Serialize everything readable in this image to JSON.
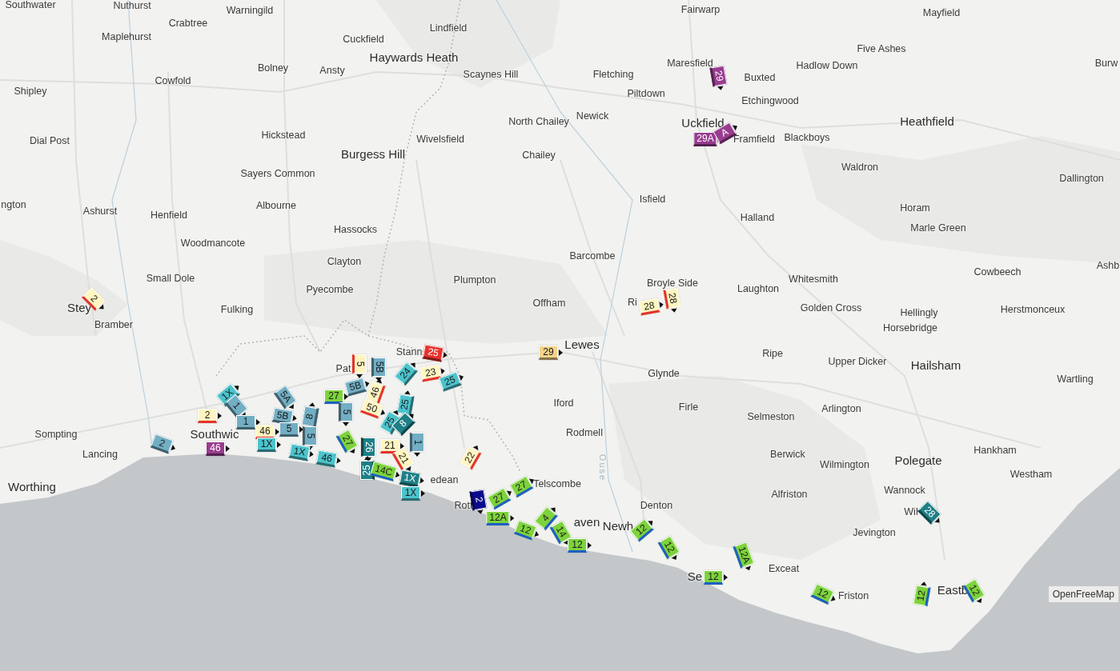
{
  "map": {
    "places": [
      {
        "name": "Southwater",
        "kind": "village"
      },
      {
        "name": "Nuthurst",
        "kind": "village"
      },
      {
        "name": "Warningild",
        "kind": "village"
      },
      {
        "name": "Crabtree",
        "kind": "village"
      },
      {
        "name": "Maplehurst",
        "kind": "village"
      },
      {
        "name": "Lindfield",
        "kind": "village"
      },
      {
        "name": "Cuckfield",
        "kind": "village"
      },
      {
        "name": "Bolney",
        "kind": "village"
      },
      {
        "name": "Haywards Heath",
        "kind": "town"
      },
      {
        "name": "Ansty",
        "kind": "village"
      },
      {
        "name": "Cowfold",
        "kind": "village"
      },
      {
        "name": "Scaynes Hill",
        "kind": "village"
      },
      {
        "name": "Shipley",
        "kind": "village"
      },
      {
        "name": "North Chailey",
        "kind": "village"
      },
      {
        "name": "Dial Post",
        "kind": "village"
      },
      {
        "name": "Hickstead",
        "kind": "village"
      },
      {
        "name": "Wivelsfield",
        "kind": "village"
      },
      {
        "name": "Burgess Hill",
        "kind": "town"
      },
      {
        "name": "Chailey",
        "kind": "village"
      },
      {
        "name": "Sayers Common",
        "kind": "village"
      },
      {
        "name": "ngton",
        "kind": "village"
      },
      {
        "name": "Ashurst",
        "kind": "village"
      },
      {
        "name": "Henfield",
        "kind": "village"
      },
      {
        "name": "Albourne",
        "kind": "village"
      },
      {
        "name": "Hassocks",
        "kind": "village"
      },
      {
        "name": "Woodmancote",
        "kind": "village"
      },
      {
        "name": "Clayton",
        "kind": "village"
      },
      {
        "name": "Small Dole",
        "kind": "village"
      },
      {
        "name": "Pyecombe",
        "kind": "village"
      },
      {
        "name": "Plumpton",
        "kind": "village"
      },
      {
        "name": "Stey",
        "kind": "town"
      },
      {
        "name": "Fulking",
        "kind": "village"
      },
      {
        "name": "Offham",
        "kind": "village"
      },
      {
        "name": "Bramber",
        "kind": "village"
      },
      {
        "name": "Fairwarp",
        "kind": "village"
      },
      {
        "name": "Mayfield",
        "kind": "village"
      },
      {
        "name": "Five Ashes",
        "kind": "village"
      },
      {
        "name": "Maresfield",
        "kind": "village"
      },
      {
        "name": "Hadlow Down",
        "kind": "village"
      },
      {
        "name": "Burw",
        "kind": "village"
      },
      {
        "name": "Fletching",
        "kind": "village"
      },
      {
        "name": "Buxted",
        "kind": "village"
      },
      {
        "name": "Piltdown",
        "kind": "village"
      },
      {
        "name": "Etchingwood",
        "kind": "village"
      },
      {
        "name": "Newick",
        "kind": "village"
      },
      {
        "name": "Uckfield",
        "kind": "town"
      },
      {
        "name": "Heathfield",
        "kind": "town"
      },
      {
        "name": "Framfield",
        "kind": "village"
      },
      {
        "name": "Blackboys",
        "kind": "village"
      },
      {
        "name": "Waldron",
        "kind": "village"
      },
      {
        "name": "Dallington",
        "kind": "village"
      },
      {
        "name": "Isfield",
        "kind": "village"
      },
      {
        "name": "Halland",
        "kind": "village"
      },
      {
        "name": "Horam",
        "kind": "village"
      },
      {
        "name": "Marle Green",
        "kind": "village"
      },
      {
        "name": "Barcombe",
        "kind": "village"
      },
      {
        "name": "Broyle Side",
        "kind": "village"
      },
      {
        "name": "Laughton",
        "kind": "village"
      },
      {
        "name": "Whitesmith",
        "kind": "village"
      },
      {
        "name": "Cowbeech",
        "kind": "village"
      },
      {
        "name": "Ashb",
        "kind": "village"
      },
      {
        "name": "Ri",
        "kind": "village"
      },
      {
        "name": "Golden Cross",
        "kind": "village"
      },
      {
        "name": "Hellingly",
        "kind": "village"
      },
      {
        "name": "Herstmonceux",
        "kind": "village"
      },
      {
        "name": "Horsebridge",
        "kind": "village"
      },
      {
        "name": "Stann",
        "kind": "village"
      },
      {
        "name": "Lewes",
        "kind": "town"
      },
      {
        "name": "Ripe",
        "kind": "village"
      },
      {
        "name": "Pat",
        "kind": "village"
      },
      {
        "name": "Glynde",
        "kind": "village"
      },
      {
        "name": "Upper Dicker",
        "kind": "village"
      },
      {
        "name": "Hailsham",
        "kind": "town"
      },
      {
        "name": "Wartling",
        "kind": "village"
      },
      {
        "name": "Iford",
        "kind": "village"
      },
      {
        "name": "Firle",
        "kind": "village"
      },
      {
        "name": "Selmeston",
        "kind": "village"
      },
      {
        "name": "Arlington",
        "kind": "village"
      },
      {
        "name": "Sompting",
        "kind": "village"
      },
      {
        "name": "Southwic",
        "kind": "town"
      },
      {
        "name": "Rodmell",
        "kind": "village"
      },
      {
        "name": "Lancing",
        "kind": "village"
      },
      {
        "name": "Ouse",
        "kind": "river"
      },
      {
        "name": "Berwick",
        "kind": "village"
      },
      {
        "name": "Wilmington",
        "kind": "village"
      },
      {
        "name": "Polegate",
        "kind": "town"
      },
      {
        "name": "Hankham",
        "kind": "village"
      },
      {
        "name": "Worthing",
        "kind": "town"
      },
      {
        "name": "edean",
        "kind": "village"
      },
      {
        "name": "Telscombe",
        "kind": "village"
      },
      {
        "name": "Westham",
        "kind": "village"
      },
      {
        "name": "Alfriston",
        "kind": "village"
      },
      {
        "name": "Wannock",
        "kind": "village"
      },
      {
        "name": "Rott",
        "kind": "village"
      },
      {
        "name": "Denton",
        "kind": "village"
      },
      {
        "name": "aven",
        "kind": "town"
      },
      {
        "name": "Newh",
        "kind": "town"
      },
      {
        "name": "Wil",
        "kind": "village"
      },
      {
        "name": "Jevington",
        "kind": "village"
      },
      {
        "name": "Se",
        "kind": "town"
      },
      {
        "name": "Exceat",
        "kind": "village"
      },
      {
        "name": "Friston",
        "kind": "village"
      },
      {
        "name": "Eastb",
        "kind": "town"
      }
    ],
    "vehicles": [
      {
        "route": "2",
        "color": "#fff5c0"
      },
      {
        "route": "29",
        "color": "#983d8f"
      },
      {
        "route": "29A",
        "color": "#983d8f"
      },
      {
        "route": "A",
        "color": "#983d8f"
      },
      {
        "route": "28",
        "color": "#fff5c0"
      },
      {
        "route": "28",
        "color": "#fff5c0"
      },
      {
        "route": "29",
        "color": "#f2d48a"
      },
      {
        "route": "25",
        "color": "#e8322f"
      },
      {
        "route": "23",
        "color": "#fff5c0"
      },
      {
        "route": "25",
        "color": "#4cc3cc"
      },
      {
        "route": "5",
        "color": "#fff5c0"
      },
      {
        "route": "5B",
        "color": "#72aec4"
      },
      {
        "route": "24",
        "color": "#4cc3cc"
      },
      {
        "route": "5B",
        "color": "#72aec4"
      },
      {
        "route": "46",
        "color": "#fff5c0"
      },
      {
        "route": "27",
        "color": "#7dd33c"
      },
      {
        "route": "1X",
        "color": "#4cc3cc"
      },
      {
        "route": "5A",
        "color": "#72aec4"
      },
      {
        "route": "25",
        "color": "#4cc3cc"
      },
      {
        "route": "1",
        "color": "#72aec4"
      },
      {
        "route": "50",
        "color": "#fff5c0"
      },
      {
        "route": "5",
        "color": "#72aec4"
      },
      {
        "route": "8",
        "color": "#72aec4"
      },
      {
        "route": "5B",
        "color": "#72aec4"
      },
      {
        "route": "25",
        "color": "#4cc3cc"
      },
      {
        "route": "8",
        "color": "#1e7f86"
      },
      {
        "route": "1",
        "color": "#72aec4"
      },
      {
        "route": "2",
        "color": "#fff5c0"
      },
      {
        "route": "5",
        "color": "#72aec4"
      },
      {
        "route": "46",
        "color": "#fff5c0"
      },
      {
        "route": "5",
        "color": "#72aec4"
      },
      {
        "route": "46",
        "color": "#983d8f"
      },
      {
        "route": "2",
        "color": "#72aec4"
      },
      {
        "route": "1X",
        "color": "#4cc3cc"
      },
      {
        "route": "27",
        "color": "#7dd33c"
      },
      {
        "route": "21",
        "color": "#fff5c0"
      },
      {
        "route": "1",
        "color": "#72aec4"
      },
      {
        "route": "26",
        "color": "#1e7f86"
      },
      {
        "route": "1X",
        "color": "#4cc3cc"
      },
      {
        "route": "22",
        "color": "#fff5c0"
      },
      {
        "route": "46",
        "color": "#4cc3cc"
      },
      {
        "route": "21",
        "color": "#fff5c0"
      },
      {
        "route": "25",
        "color": "#1e7f86"
      },
      {
        "route": "14C",
        "color": "#7dd33c"
      },
      {
        "route": "1X",
        "color": "#1e7f86"
      },
      {
        "route": "1X",
        "color": "#4cc3cc"
      },
      {
        "route": "27",
        "color": "#7dd33c"
      },
      {
        "route": "27",
        "color": "#7dd33c"
      },
      {
        "route": "2",
        "color": "#0b0b8c"
      },
      {
        "route": "12A",
        "color": "#7dd33c"
      },
      {
        "route": "12",
        "color": "#7dd33c"
      },
      {
        "route": "4",
        "color": "#7dd33c"
      },
      {
        "route": "14",
        "color": "#7dd33c"
      },
      {
        "route": "12",
        "color": "#7dd33c"
      },
      {
        "route": "12",
        "color": "#7dd33c"
      },
      {
        "route": "12",
        "color": "#7dd33c"
      },
      {
        "route": "12",
        "color": "#7dd33c"
      },
      {
        "route": "12A",
        "color": "#7dd33c"
      },
      {
        "route": "12",
        "color": "#7dd33c"
      },
      {
        "route": "28",
        "color": "#1e7f86"
      },
      {
        "route": "12",
        "color": "#7dd33c"
      },
      {
        "route": "12",
        "color": "#7dd33c"
      }
    ],
    "attribution": "OpenFreeMap"
  }
}
